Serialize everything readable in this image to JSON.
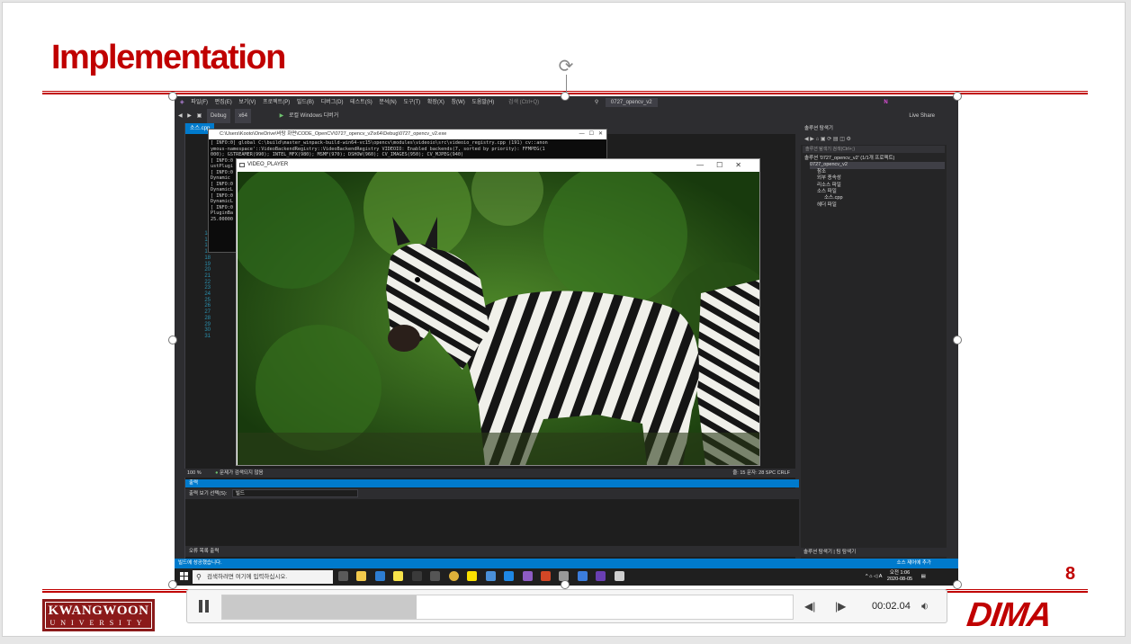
{
  "slide": {
    "title": "Implementation",
    "page_number": "8",
    "logo_left_line1": "KWANGWOON",
    "logo_left_line2": "UNIVERSITY",
    "logo_right": "DIMA"
  },
  "vs": {
    "menu": [
      "파일(F)",
      "편집(E)",
      "보기(V)",
      "프로젝트(P)",
      "빌드(B)",
      "디버그(D)",
      "테스트(S)",
      "분석(N)",
      "도구(T)",
      "확장(X)",
      "창(W)",
      "도움말(H)",
      "검색 (Ctrl+Q)",
      "0727_opencv_v2"
    ],
    "debug_config": "Debug",
    "platform": "x64",
    "run_label": "로컬 Windows 디버거",
    "live_share": "Live Share",
    "editor_tab": "소스.cpp",
    "line_numbers": [
      "14",
      "15",
      "16",
      "17",
      "18",
      "19",
      "20",
      "21",
      "22",
      "23",
      "24",
      "25",
      "26",
      "27",
      "28",
      "29",
      "30",
      "31"
    ],
    "zoom": "100 %",
    "issues": "문제가 검색되지 않음",
    "cursor": "줄: 15    문자: 28    SPC    CRLF",
    "output_header": "출력",
    "output_source_label": "출력 보기 선택(S):",
    "output_source_value": "빌드",
    "bottom_tabs": "오류 목록   출력",
    "solution_explorer_title": "솔루션 탐색기",
    "solution_search": "솔루션 탐색기 검색(Ctrl+;)",
    "tree": [
      "솔루션 '0727_opencv_v2' (1/1개 프로젝트)",
      "0727_opencv_v2",
      "참조",
      "외부 종속성",
      "리소스 파일",
      "소스 파일",
      "소스.cpp",
      "헤더 파일"
    ],
    "right_bottom_tabs": "솔루션 탐색기 | 팀 탐색기",
    "status_message": "빌드에 성공했습니다.",
    "status_right": "소스 제어에 추가"
  },
  "console": {
    "title": "C:\\Users\\Kooto\\OneDrive\\바탕 화면\\CODE_OpenCV\\0727_opencv_v2\\x64\\Debug\\0727_opencv_v2.exe",
    "lines": [
      "[ INFO:0] global C:\\build\\master_winpack-build-win64-vc15\\opencv\\modules\\videoio\\src\\videoio_registry.cpp (191) cv::anon",
      "ymous-namespace'::VideoBackendRegistry::VideoBackendRegistry VIDEOIO: Enabled backends(7, sorted by priority): FFMPEG(1",
      "000); GSTREAMER(990); INTEL_MFX(980); MSMF(970); DSHOW(960); CV_IMAGES(950); CV_MJPEG(940)",
      "[ INFO:0",
      "ustPlugi",
      "[ INFO:0",
      "Dynamic",
      "[ INFO:0",
      "DynamicL",
      "[ INFO:0",
      "DynamicL",
      "[ INFO:0",
      "PluginBa",
      "25.00000"
    ]
  },
  "player": {
    "title": "VIDEO_PLAYER"
  },
  "taskbar": {
    "search_placeholder": "검색하려면 여기에 입력하십시오.",
    "time": "오전 1:06",
    "date": "2020-08-05",
    "lang": "A"
  },
  "video_controls": {
    "time": "00:02.04",
    "progress": 0.34
  },
  "colors": {
    "accent_red": "#c00000",
    "vs_blue": "#007acc"
  }
}
